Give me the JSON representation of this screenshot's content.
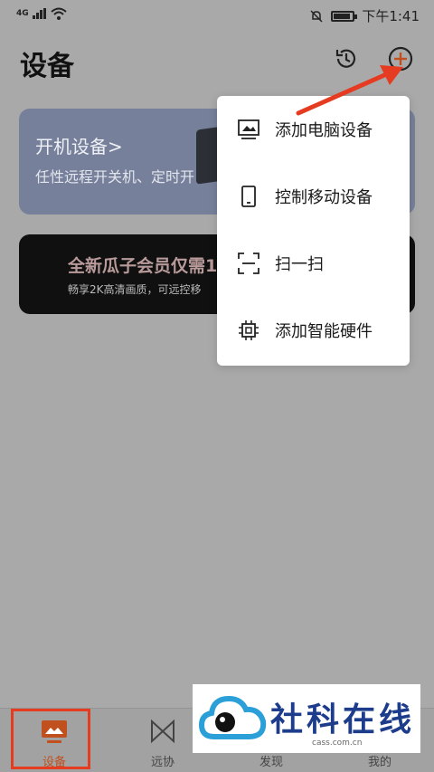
{
  "status_bar": {
    "network": "4G",
    "time": "下午1:41",
    "battery_level": 0.8
  },
  "header": {
    "title": "设备",
    "history_icon": "history-icon",
    "add_icon": "add-circle-icon"
  },
  "cards": {
    "power": {
      "title": "开机设备",
      "chevron": ">",
      "desc": "任性远程开关机、定时开"
    },
    "vip": {
      "title": "全新瓜子会员仅需1",
      "desc": "畅享2K高清画质，可远控移"
    }
  },
  "menu": {
    "items": [
      {
        "label": "添加电脑设备",
        "icon": "monitor-icon"
      },
      {
        "label": "控制移动设备",
        "icon": "phone-icon"
      },
      {
        "label": "扫一扫",
        "icon": "scan-icon"
      },
      {
        "label": "添加智能硬件",
        "icon": "chip-icon"
      }
    ]
  },
  "tabbar": {
    "tabs": [
      {
        "label": "设备",
        "active": true
      },
      {
        "label": "远协",
        "active": false
      },
      {
        "label": "发现",
        "active": false
      },
      {
        "label": "我的",
        "active": false
      }
    ]
  },
  "watermark": {
    "title": "社科在线",
    "sub": "cass.com.cn"
  },
  "colors": {
    "accent": "#c0501e",
    "annotation_red": "#e53b20",
    "overlay": "#a9a9a9"
  }
}
